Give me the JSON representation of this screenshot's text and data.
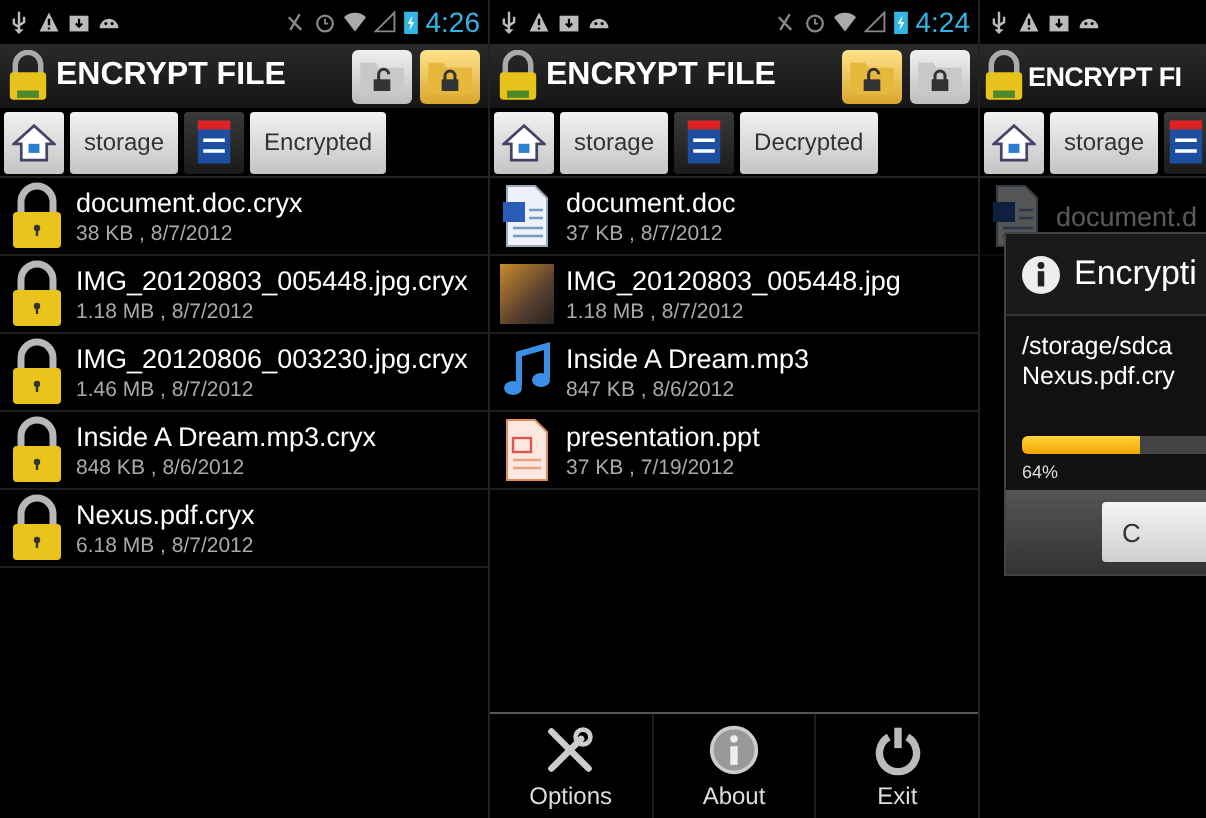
{
  "screens": [
    {
      "status_bar": {
        "time": "4:26"
      },
      "title": "ENCRYPT FILE",
      "mode_buttons": [
        {
          "kind": "unlock",
          "selected": false
        },
        {
          "kind": "lock",
          "selected": true
        }
      ],
      "breadcrumb": [
        {
          "kind": "home"
        },
        {
          "kind": "label",
          "label": "storage"
        },
        {
          "kind": "card"
        },
        {
          "kind": "label",
          "label": "Encrypted"
        }
      ],
      "files": [
        {
          "kind": "locked",
          "name": "document.doc.cryx",
          "info": "38 KB , 8/7/2012"
        },
        {
          "kind": "locked",
          "name": "IMG_20120803_005448.jpg.cryx",
          "info": "1.18 MB , 8/7/2012"
        },
        {
          "kind": "locked",
          "name": "IMG_20120806_003230.jpg.cryx",
          "info": "1.46 MB , 8/7/2012"
        },
        {
          "kind": "locked",
          "name": "Inside A Dream.mp3.cryx",
          "info": "848 KB , 8/6/2012"
        },
        {
          "kind": "locked",
          "name": "Nexus.pdf.cryx",
          "info": "6.18 MB , 8/7/2012"
        }
      ]
    },
    {
      "status_bar": {
        "time": "4:24"
      },
      "title": "ENCRYPT FILE",
      "mode_buttons": [
        {
          "kind": "unlock",
          "selected": true
        },
        {
          "kind": "lock",
          "selected": false
        }
      ],
      "breadcrumb": [
        {
          "kind": "home"
        },
        {
          "kind": "label",
          "label": "storage"
        },
        {
          "kind": "card"
        },
        {
          "kind": "label",
          "label": "Decrypted"
        }
      ],
      "files": [
        {
          "kind": "doc",
          "name": "document.doc",
          "info": "37 KB , 8/7/2012"
        },
        {
          "kind": "image",
          "name": "IMG_20120803_005448.jpg",
          "info": "1.18 MB , 8/7/2012"
        },
        {
          "kind": "audio",
          "name": "Inside A Dream.mp3",
          "info": "847 KB , 8/6/2012"
        },
        {
          "kind": "slides",
          "name": "presentation.ppt",
          "info": "37 KB , 7/19/2012"
        }
      ],
      "menu": [
        {
          "kind": "options",
          "label": "Options"
        },
        {
          "kind": "about",
          "label": "About"
        },
        {
          "kind": "exit",
          "label": "Exit"
        }
      ]
    },
    {
      "title": "ENCRYPT FI",
      "breadcrumb": [
        {
          "kind": "home"
        },
        {
          "kind": "label",
          "label": "storage"
        },
        {
          "kind": "card"
        }
      ],
      "files": [
        {
          "kind": "doc",
          "name": "document.d"
        }
      ],
      "dialog": {
        "title": "Encrypti",
        "lines": [
          "/storage/sdca",
          "Nexus.pdf.cry"
        ],
        "level": 0.64,
        "percent": "64%",
        "button": "C"
      }
    }
  ]
}
